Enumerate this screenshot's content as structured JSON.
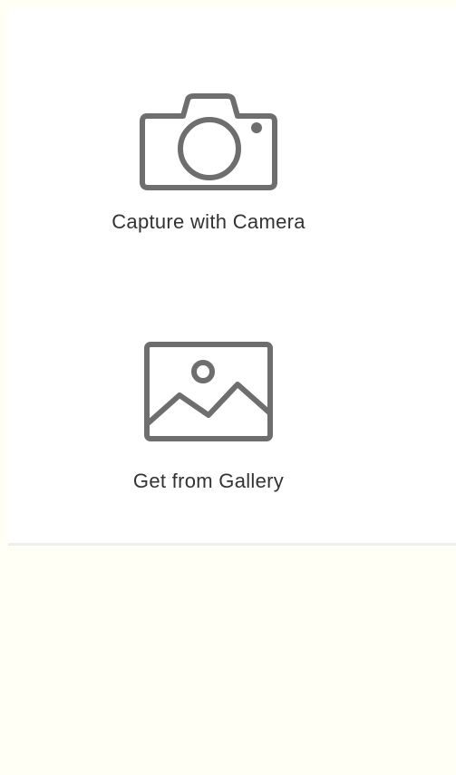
{
  "options": {
    "camera": {
      "label": "Capture with Camera",
      "icon": "camera-icon"
    },
    "gallery": {
      "label": "Get from Gallery",
      "icon": "image-icon"
    }
  },
  "colors": {
    "icon": "#6e6e6e",
    "text": "#333333",
    "sheet": "#ffffff",
    "background": "#fffff6"
  }
}
